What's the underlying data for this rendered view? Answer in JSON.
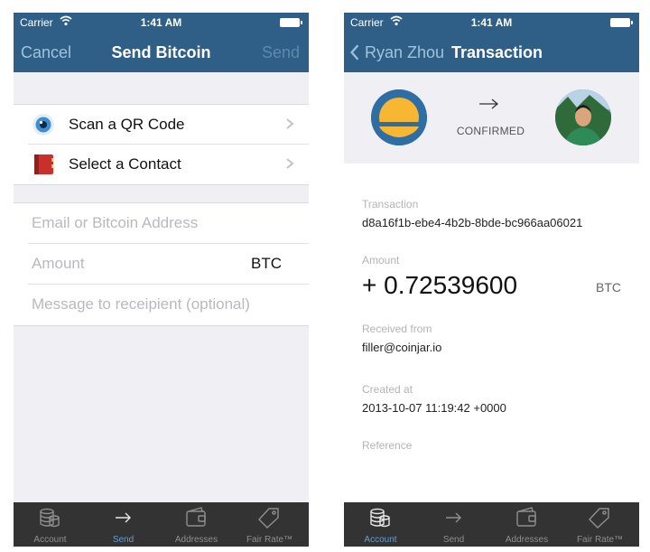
{
  "send_screen": {
    "status": {
      "carrier": "Carrier",
      "time": "1:41 AM"
    },
    "nav": {
      "left": "Cancel",
      "title": "Send Bitcoin",
      "right": "Send"
    },
    "options": [
      {
        "label": "Scan a QR Code",
        "icon": "eye-icon"
      },
      {
        "label": "Select a Contact",
        "icon": "address-book-icon"
      }
    ],
    "form": {
      "address_placeholder": "Email or Bitcoin Address",
      "amount_placeholder": "Amount",
      "amount_unit": "BTC",
      "message_placeholder": "Message to receipient (optional)"
    },
    "tabs": [
      {
        "label": "Account",
        "icon": "coins-icon"
      },
      {
        "label": "Send",
        "icon": "arrow-right-icon",
        "active": true
      },
      {
        "label": "Addresses",
        "icon": "wallet-icon"
      },
      {
        "label": "Fair Rate™",
        "icon": "price-tag-icon"
      }
    ]
  },
  "transaction_screen": {
    "status": {
      "carrier": "Carrier",
      "time": "1:41 AM"
    },
    "nav": {
      "back": "Ryan Zhou",
      "title": "Transaction"
    },
    "header": {
      "status": "CONFIRMED"
    },
    "transaction_label": "Transaction",
    "transaction_id": "d8a16f1b-ebe4-4b2b-8bde-bc966aa06021",
    "amount_label": "Amount",
    "amount_value": "+ 0.72539600",
    "amount_unit": "BTC",
    "received_label": "Received from",
    "received_value": "filler@coinjar.io",
    "created_label": "Created at",
    "created_value": "2013-10-07 11:19:42 +0000",
    "reference_label": "Reference",
    "tabs": [
      {
        "label": "Account",
        "icon": "coins-icon",
        "active": true
      },
      {
        "label": "Send",
        "icon": "arrow-right-icon"
      },
      {
        "label": "Addresses",
        "icon": "wallet-icon"
      },
      {
        "label": "Fair Rate™",
        "icon": "price-tag-icon"
      }
    ]
  },
  "colors": {
    "nav_bar": "#2f5f86",
    "tab_bar": "#333333",
    "active_tab": "#5aa0d8",
    "background": "#efeff4"
  }
}
